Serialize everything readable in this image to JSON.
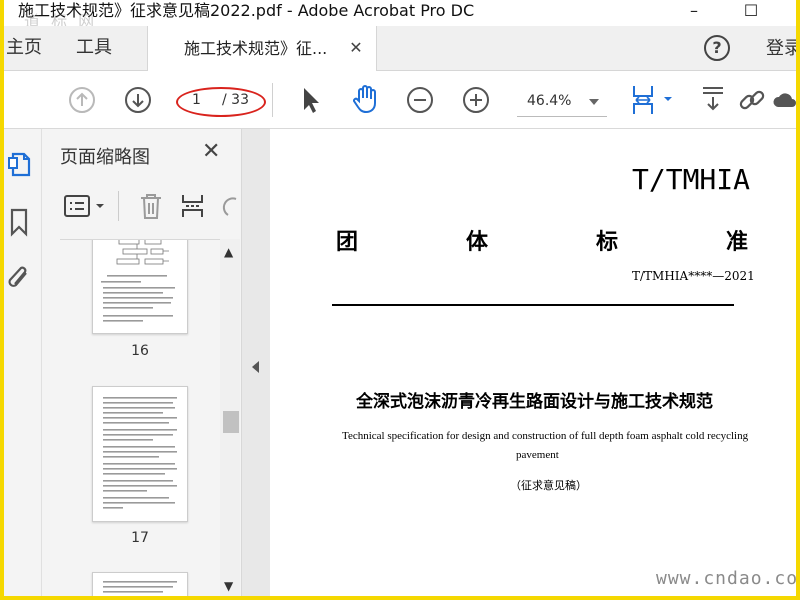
{
  "window": {
    "title": "施工技术规范》征求意见稿2022.pdf - Adobe Acrobat Pro DC",
    "watermark": "道 标 网"
  },
  "tabbar": {
    "home": "主页",
    "tools": "工具",
    "doc_tab": "施工技术规范》征...",
    "close_glyph": "✕",
    "help_glyph": "?",
    "login": "登录"
  },
  "toolbar": {
    "current_page": "1",
    "total_pages": "/ 33",
    "zoom": "46.4%"
  },
  "thumbnails": {
    "title": "页面缩略图",
    "close_glyph": "✕",
    "pages": [
      "16",
      "17"
    ]
  },
  "document": {
    "standard_code": "T/TMHIA",
    "standard_type_chars": [
      "团",
      "体",
      "标",
      "准"
    ],
    "standard_number": "T/TMHIA****—2021",
    "title_cn": "全深式泡沫沥青冷再生路面设计与施工技术规范",
    "title_en_line1": "Technical specification for design and construction of full depth foam asphalt cold recycling",
    "title_en_line2": "pavement",
    "draft_label": "（征求意见稿）"
  },
  "site_watermark": "www.cndao.com",
  "colors": {
    "accent_blue": "#1f6fd6",
    "annotation_red": "#d9231d",
    "frame_yellow": "#f5d800"
  }
}
